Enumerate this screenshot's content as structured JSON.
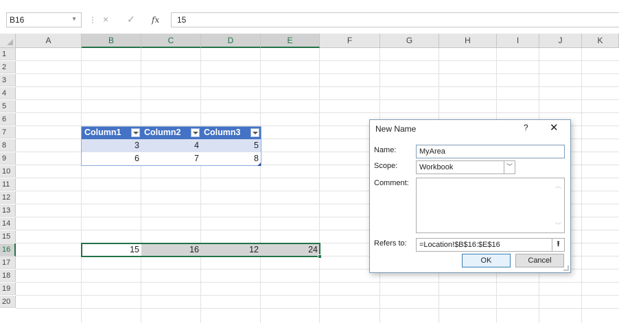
{
  "formula_bar": {
    "name_box": "B16",
    "cancel_icon": "×",
    "enter_icon": "✓",
    "fx_label": "fx",
    "formula": "15"
  },
  "columns": [
    "A",
    "B",
    "C",
    "D",
    "E",
    "F",
    "G",
    "H",
    "I",
    "J",
    "K"
  ],
  "selected_columns": [
    "B",
    "C",
    "D",
    "E"
  ],
  "rows": [
    "1",
    "2",
    "3",
    "4",
    "5",
    "6",
    "7",
    "8",
    "9",
    "10",
    "11",
    "12",
    "13",
    "14",
    "15",
    "16",
    "17",
    "18",
    "19",
    "20"
  ],
  "selected_row": "16",
  "table": {
    "headers": [
      "Column1",
      "Column2",
      "Column3"
    ],
    "rows": [
      [
        "3",
        "4",
        "5"
      ],
      [
        "6",
        "7",
        "8"
      ]
    ],
    "header_color": "#4472c4",
    "band_color": "#d9e1f2"
  },
  "selected_range": {
    "values": [
      "15",
      "16",
      "12",
      "24"
    ],
    "accent": "#217346"
  },
  "dialog": {
    "title": "New Name",
    "help": "?",
    "close": "✕",
    "name_label": "Name:",
    "name_value": "MyArea",
    "scope_label": "Scope:",
    "scope_value": "Workbook",
    "comment_label": "Comment:",
    "refers_label": "Refers to:",
    "refers_value": "=Location!$B$16:$E$16",
    "ok_label": "OK",
    "cancel_label": "Cancel"
  }
}
